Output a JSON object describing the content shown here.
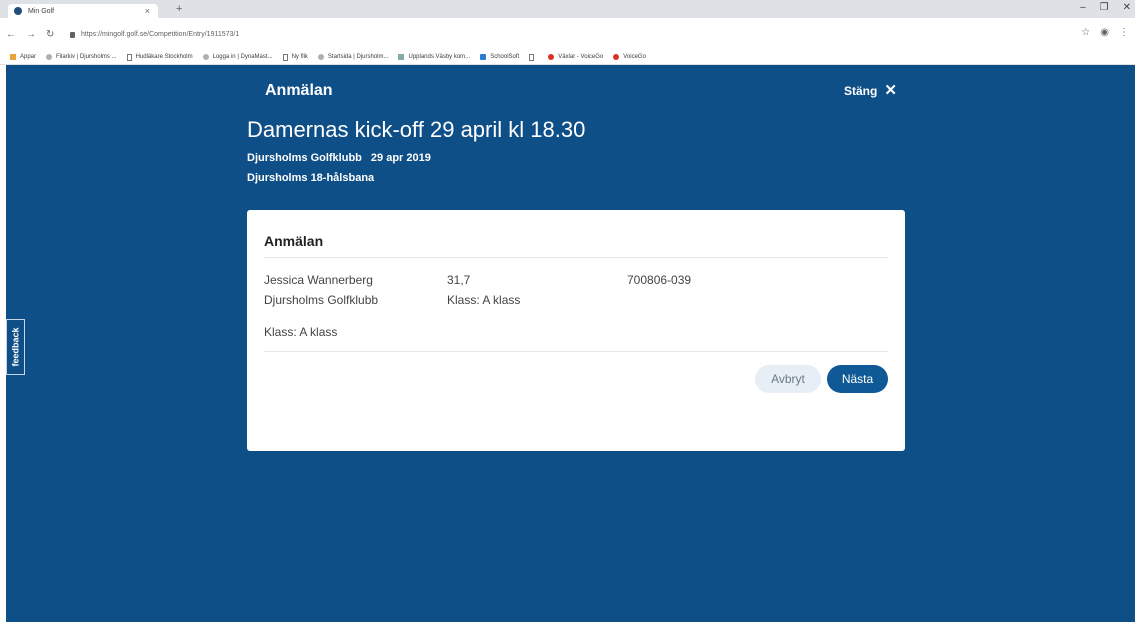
{
  "browser": {
    "tab_title": "Min Golf",
    "tab_close": "×",
    "new_tab": "+",
    "url_host": "https://mingolf.golf.se",
    "url_path": "/Competition/Entry/1911573/1",
    "bookmarks": [
      {
        "label": "Appar",
        "icon": "apps-grid-icon"
      },
      {
        "label": "Filarkiv | Djursholms ...",
        "icon": "site-icon"
      },
      {
        "label": "Hudläkare Stockholm",
        "icon": "page-icon"
      },
      {
        "label": "Logga in | DynaMast...",
        "icon": "site-icon"
      },
      {
        "label": "Ny flik",
        "icon": "page-icon"
      },
      {
        "label": "Startsida | Djursholm...",
        "icon": "site-icon"
      },
      {
        "label": "Upplands Väsby kom...",
        "icon": "funnel-icon"
      },
      {
        "label": "SchoolSoft",
        "icon": "schoolsoft-icon"
      },
      {
        "label": "",
        "icon": "page-icon"
      },
      {
        "label": "Växlar - VoiceGo",
        "icon": "voicego-icon"
      },
      {
        "label": "VoiceGo",
        "icon": "voicego-icon"
      }
    ]
  },
  "feedback_tab": "feedback",
  "header": {
    "title": "Anmälan",
    "close_label": "Stäng",
    "close_glyph": "✕"
  },
  "competition": {
    "title": "Damernas kick-off 29 april kl 18.30",
    "club": "Djursholms Golfklubb",
    "date": "29 apr 2019",
    "course": "Djursholms 18-hålsbana"
  },
  "card": {
    "title": "Anmälan",
    "player_name": "Jessica Wannerberg",
    "player_club": "Djursholms Golfklubb",
    "handicap": "31,7",
    "class_inline": "Klass: A klass",
    "golf_id": "700806-039",
    "class_summary": "Klass: A klass",
    "cancel_label": "Avbryt",
    "next_label": "Nästa"
  }
}
